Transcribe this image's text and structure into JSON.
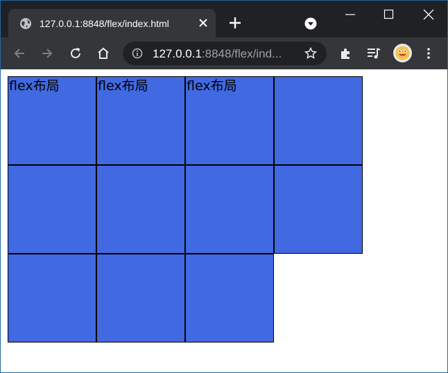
{
  "browser": {
    "tab": {
      "title": "127.0.0.1:8848/flex/index.html"
    },
    "address": {
      "host": "127.0.0.1",
      "rest": ":8848/flex/ind..."
    },
    "icons": {
      "favicon": "globe-icon",
      "tab_close": "close-icon",
      "new_tab": "plus-icon",
      "tab_search": "chevron-down-circle-icon",
      "minimize": "minimize-icon",
      "maximize": "maximize-icon",
      "close": "close-icon",
      "back": "arrow-left-icon",
      "forward": "arrow-right-icon",
      "reload": "reload-icon",
      "home": "home-icon",
      "site_info": "info-icon",
      "bookmark": "star-icon",
      "extensions": "puzzle-icon",
      "media": "music-queue-icon",
      "profile": "avatar-emoji-icon",
      "menu": "kebab-menu-icon"
    },
    "colors": {
      "frame": "#202124",
      "toolbar": "#35363a",
      "omnibox": "#202124"
    }
  },
  "page": {
    "items": [
      {
        "label": "flex布局"
      },
      {
        "label": "flex布局"
      },
      {
        "label": "flex布局"
      },
      {
        "label": ""
      },
      {
        "label": ""
      },
      {
        "label": ""
      },
      {
        "label": ""
      },
      {
        "label": ""
      },
      {
        "label": ""
      },
      {
        "label": ""
      },
      {
        "label": ""
      }
    ],
    "colors": {
      "item_bg": "#4169e1",
      "item_border": "#000000"
    }
  }
}
